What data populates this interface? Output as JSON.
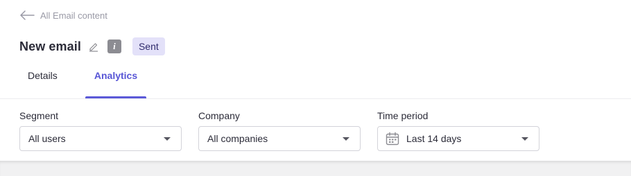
{
  "header": {
    "back_label": "All Email content",
    "title": "New email",
    "info_icon_glyph": "i",
    "status": "Sent"
  },
  "tabs": [
    {
      "label": "Details",
      "active": false
    },
    {
      "label": "Analytics",
      "active": true
    }
  ],
  "filters": {
    "segment": {
      "label": "Segment",
      "value": "All users"
    },
    "company": {
      "label": "Company",
      "value": "All companies"
    },
    "time_period": {
      "label": "Time period",
      "value": "Last 14 days",
      "icon": "calendar-icon"
    }
  },
  "colors": {
    "accent": "#5856d6",
    "badge_bg": "#e3e1f9",
    "badge_text": "#2e2a6b",
    "muted_text": "#9a9aa6"
  }
}
